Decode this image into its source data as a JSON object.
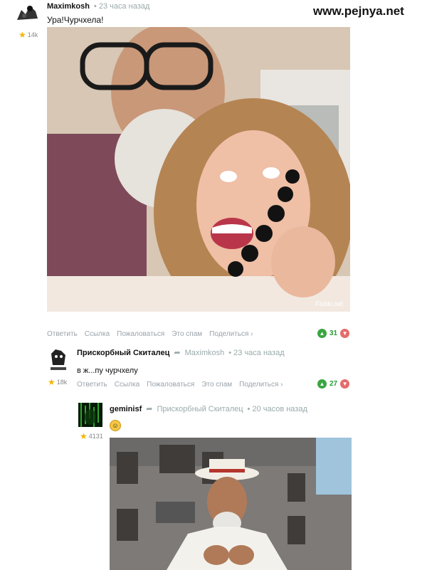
{
  "watermark": "www.pejnya.net",
  "comment1": {
    "author": "Maximkosh",
    "time": "• 23 часа назад",
    "text": "Ура!Чурчхела!",
    "rating": "14k",
    "photo_credit": "Fishki.net",
    "actions": [
      "Ответить",
      "Ссылка",
      "Пожаловаться",
      "Это спам",
      "Поделиться ›"
    ],
    "votes": "31"
  },
  "comment2": {
    "author": "Прискорбный Скиталец",
    "reply_to": "Maximkosh",
    "time": "• 23 часа назад",
    "text": "в ж...пу чурчхелу",
    "rating": "18k",
    "actions": [
      "Ответить",
      "Ссылка",
      "Пожаловаться",
      "Это спам",
      "Поделиться ›"
    ],
    "votes": "27"
  },
  "comment3": {
    "author": "geminisf",
    "reply_to": "Прискорбный Скиталец",
    "time": "• 20 часов назад",
    "rating": "4131"
  },
  "icons": {
    "star": "star-icon",
    "reply_arrow": "reply-arrow-icon",
    "upvote": "thumb-up-icon",
    "downvote": "thumb-down-icon"
  },
  "colors": {
    "upvote": "#3aa540",
    "downvote": "#e66b6b",
    "meta": "#9aa3ab"
  }
}
